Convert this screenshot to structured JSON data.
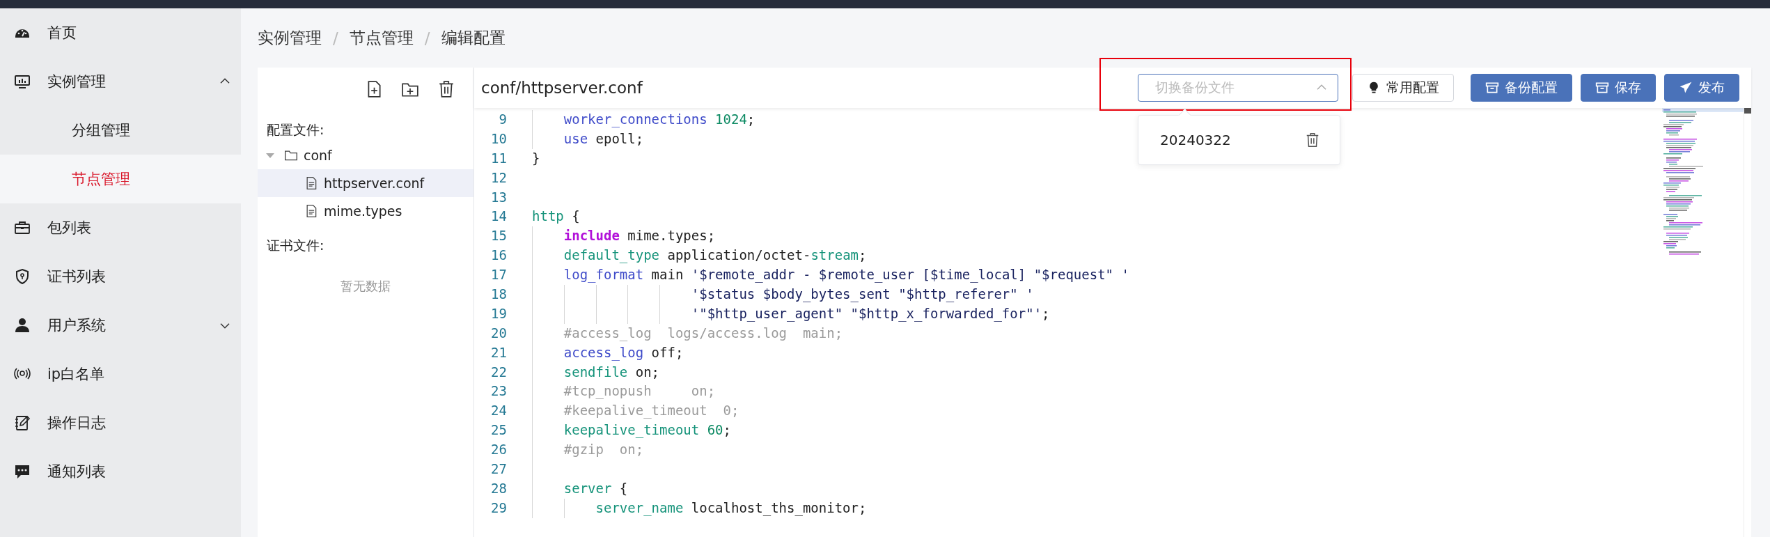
{
  "sidebar": {
    "items": [
      {
        "label": "首页",
        "selected": false
      },
      {
        "label": "实例管理",
        "selected": false,
        "expanded": true,
        "children": [
          {
            "label": "分组管理",
            "selected": false
          },
          {
            "label": "节点管理",
            "selected": true
          }
        ]
      },
      {
        "label": "包列表",
        "selected": false
      },
      {
        "label": "证书列表",
        "selected": false
      },
      {
        "label": "用户系统",
        "selected": false,
        "expanded": false
      },
      {
        "label": "ip白名单",
        "selected": false
      },
      {
        "label": "操作日志",
        "selected": false
      },
      {
        "label": "通知列表",
        "selected": false
      }
    ]
  },
  "breadcrumb": [
    {
      "kind": "crumb",
      "text": "实例管理"
    },
    {
      "kind": "separator",
      "text": "/"
    },
    {
      "kind": "crumb",
      "text": "节点管理"
    },
    {
      "kind": "separator",
      "text": "/"
    },
    {
      "kind": "crumb",
      "text": "编辑配置"
    }
  ],
  "file_panel": {
    "config_label": "配置文件:",
    "tree": [
      {
        "label": "conf",
        "kind": "folder",
        "expanded": true,
        "selected": false,
        "children": [
          {
            "label": "httpserver.conf",
            "kind": "file",
            "selected": true
          },
          {
            "label": "mime.types",
            "kind": "file",
            "selected": false
          }
        ]
      }
    ],
    "cert_label": "证书文件:",
    "cert_empty": "暂无数据"
  },
  "editor": {
    "title": "conf/httpserver.conf",
    "backup_select": {
      "placeholder": "切换备份文件",
      "expanded": true,
      "highlighted": true,
      "options": [
        {
          "label": "20240322"
        }
      ]
    },
    "buttons": [
      {
        "label": "常用配置",
        "kind": "plain"
      },
      {
        "label": "备份配置",
        "kind": "primary"
      },
      {
        "label": "保存",
        "kind": "primary"
      },
      {
        "label": "发布",
        "kind": "primary"
      }
    ],
    "lines": [
      {
        "children": [
          {
            "number": "9",
            "tokens": [
              {
                "kind": "directive",
                "text": "worker_connections"
              },
              {
                "kind": "number",
                "text": " 1024"
              },
              {
                "kind": "plain",
                "text": ";"
              }
            ]
          },
          {
            "number": "10",
            "tokens": [
              {
                "kind": "directive",
                "text": "use"
              },
              {
                "kind": "plain",
                "text": " epoll;"
              }
            ]
          }
        ]
      },
      {
        "number": "11",
        "tokens": [
          {
            "kind": "plain",
            "text": "}"
          }
        ]
      },
      {
        "number": "12"
      },
      {
        "number": "13"
      },
      {
        "number": "14",
        "tokens": [
          {
            "kind": "block",
            "text": "http"
          },
          {
            "kind": "plain",
            "text": " {"
          }
        ],
        "children": [
          {
            "number": "15",
            "tokens": [
              {
                "kind": "include",
                "text": "include"
              },
              {
                "kind": "plain",
                "text": " mime.types;"
              }
            ]
          },
          {
            "number": "16",
            "tokens": [
              {
                "kind": "block",
                "text": "default_type"
              },
              {
                "kind": "plain",
                "text": " application/octet-"
              },
              {
                "kind": "block",
                "text": "stream"
              },
              {
                "kind": "plain",
                "text": ";"
              }
            ]
          },
          {
            "number": "17",
            "tokens": [
              {
                "kind": "directive",
                "text": "log_format"
              },
              {
                "kind": "plain",
                "text": " main "
              },
              {
                "kind": "string",
                "text": "'$remote_addr - $remote_user [$time_local] \"$request\" '"
              }
            ],
            "continued": [
              {
                "number": "18",
                "tokens": [
                  {
                    "kind": "string",
                    "text": "'$status $body_bytes_sent \"$http_referer\" '"
                  }
                ]
              },
              {
                "number": "19",
                "tokens": [
                  {
                    "kind": "string",
                    "text": "'\"$http_user_agent\" \"$http_x_forwarded_for\"'"
                  },
                  {
                    "kind": "plain",
                    "text": ";"
                  }
                ]
              }
            ]
          },
          {
            "number": "20",
            "tokens": [
              {
                "kind": "comment",
                "text": "#access_log  logs/access.log  main;"
              }
            ]
          },
          {
            "number": "21",
            "tokens": [
              {
                "kind": "directive",
                "text": "access_log"
              },
              {
                "kind": "plain",
                "text": " off;"
              }
            ]
          },
          {
            "number": "22",
            "tokens": [
              {
                "kind": "block",
                "text": "sendfile"
              },
              {
                "kind": "plain",
                "text": " on;"
              }
            ]
          },
          {
            "number": "23",
            "tokens": [
              {
                "kind": "comment",
                "text": "#tcp_nopush     on;"
              }
            ]
          },
          {
            "number": "24",
            "tokens": [
              {
                "kind": "comment",
                "text": "#keepalive_timeout  0;"
              }
            ]
          },
          {
            "number": "25",
            "tokens": [
              {
                "kind": "block",
                "text": "keepalive_timeout"
              },
              {
                "kind": "number",
                "text": " 60"
              },
              {
                "kind": "plain",
                "text": ";"
              }
            ]
          },
          {
            "number": "26",
            "tokens": [
              {
                "kind": "comment",
                "text": "#gzip  on;"
              }
            ]
          },
          {
            "number": "27"
          },
          {
            "number": "28",
            "tokens": [
              {
                "kind": "block",
                "text": "server"
              },
              {
                "kind": "plain",
                "text": " {"
              }
            ],
            "children": [
              {
                "number": "29",
                "tokens": [
                  {
                    "kind": "block",
                    "text": "server_name"
                  },
                  {
                    "kind": "plain",
                    "text": " localhost_ths_monitor;"
                  }
                ]
              }
            ]
          }
        ]
      }
    ]
  }
}
